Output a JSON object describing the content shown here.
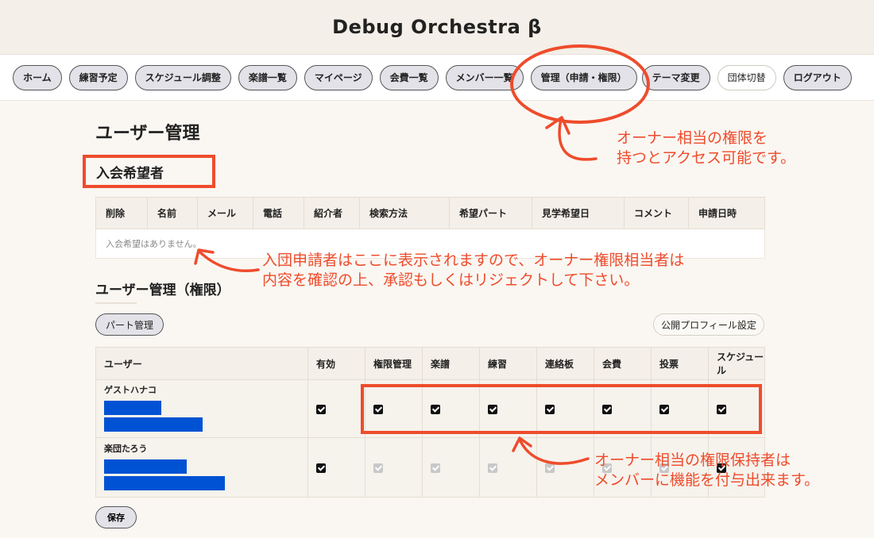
{
  "site": {
    "title": "Debug Orchestra β"
  },
  "nav": {
    "items": [
      {
        "id": "home",
        "label": "ホーム"
      },
      {
        "id": "practice",
        "label": "練習予定"
      },
      {
        "id": "schedule",
        "label": "スケジュール調整"
      },
      {
        "id": "scores",
        "label": "楽譜一覧"
      },
      {
        "id": "mypage",
        "label": "マイページ"
      },
      {
        "id": "fees",
        "label": "会費一覧"
      },
      {
        "id": "members",
        "label": "メンバー一覧"
      },
      {
        "id": "admin",
        "label": "管理（申請・権限）"
      },
      {
        "id": "theme",
        "label": "テーマ変更"
      },
      {
        "id": "switch",
        "label": "団体切替"
      },
      {
        "id": "logout",
        "label": "ログアウト"
      }
    ]
  },
  "page": {
    "title": "ユーザー管理",
    "applicants": {
      "title": "入会希望者",
      "headers": [
        "削除",
        "名前",
        "メール",
        "電話",
        "紹介者",
        "検索方法",
        "希望パート",
        "見学希望日",
        "コメント",
        "申請日時"
      ],
      "empty_message": "入会希望はありません。"
    },
    "permissions": {
      "title": "ユーザー管理（権限）",
      "part_button": "パート管理",
      "profile_button": "公開プロフィール設定",
      "headers": [
        "ユーザー",
        "有効",
        "権限管理",
        "楽譜",
        "練習",
        "連絡板",
        "会費",
        "投票",
        "スケジュール"
      ],
      "users": [
        {
          "name": "ゲストハナコ",
          "checks": [
            true,
            true,
            true,
            true,
            true,
            true,
            true,
            true
          ],
          "enabled": [
            true,
            true,
            true,
            true,
            true,
            true,
            true,
            true
          ]
        },
        {
          "name": "楽団たろう",
          "checks": [
            true,
            true,
            true,
            true,
            true,
            true,
            true,
            true
          ],
          "enabled": [
            true,
            false,
            false,
            false,
            false,
            false,
            false,
            true
          ]
        }
      ],
      "save_button": "保存"
    }
  },
  "annotations": {
    "nav_note": "オーナー相当の権限を\n持つとアクセス可能です。",
    "applicant_note": "入団申請者はここに表示されますので、オーナー権限相当者は\n内容を確認の上、承認もしくはリジェクトして下さい。",
    "perm_note": "オーナー相当の権限保持者は\nメンバーに機能を付与出来ます。",
    "color": "#ee4c2c"
  },
  "colors": {
    "header_bg": "#f4efe8",
    "page_bg": "#faf7f2",
    "redaction": "#0052d4"
  }
}
